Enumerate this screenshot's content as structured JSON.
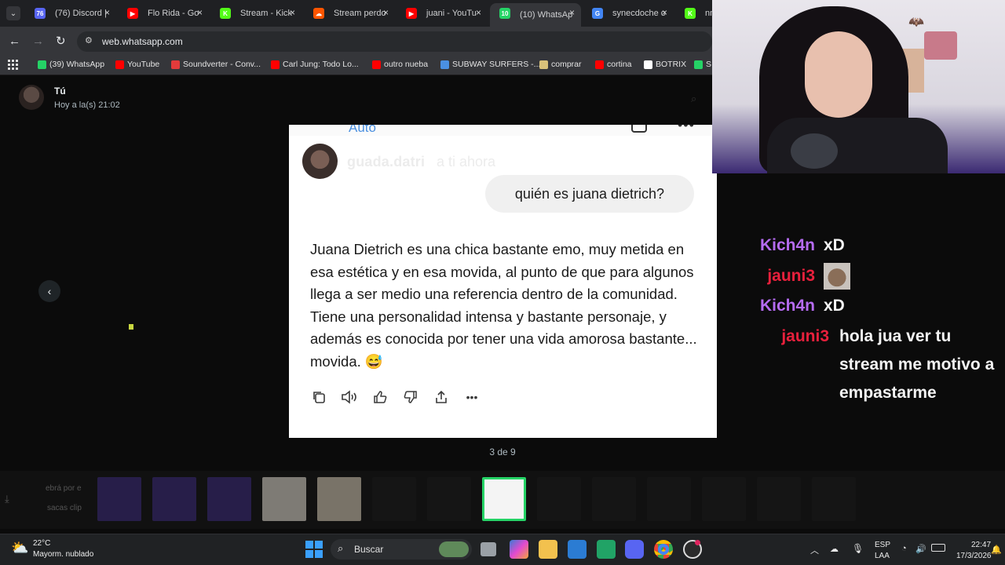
{
  "browser": {
    "tabs": [
      {
        "label": "(76) Discord |",
        "badge": "76",
        "color": "#5865f2"
      },
      {
        "label": "Flo Rida - Go",
        "badge": "▶",
        "color": "#ff0000"
      },
      {
        "label": "Stream - Kick",
        "badge": "K",
        "color": "#53fc18"
      },
      {
        "label": "Stream perdo",
        "badge": "☁",
        "color": "#ff5500"
      },
      {
        "label": "juani - YouTu",
        "badge": "▶",
        "color": "#ff0000"
      },
      {
        "label": "(10) WhatsAp",
        "badge": "10",
        "color": "#25d366"
      },
      {
        "label": "synecdoche o",
        "badge": "G",
        "color": "#4285f4"
      },
      {
        "label": "nnig",
        "badge": "K",
        "color": "#53fc18"
      }
    ],
    "url": "web.whatsapp.com",
    "bookmarks": [
      {
        "label": "(39) WhatsApp",
        "color": "#25d366"
      },
      {
        "label": "YouTube",
        "color": "#ff0000"
      },
      {
        "label": "Soundverter - Conv...",
        "color": "#e23b3b"
      },
      {
        "label": "Carl Jung: Todo Lo...",
        "color": "#ff0000"
      },
      {
        "label": "outro nueba",
        "color": "#ff0000"
      },
      {
        "label": "SUBWAY SURFERS -...",
        "color": "#4a90e2"
      },
      {
        "label": "comprar",
        "color": "#d9c27a"
      },
      {
        "label": "cortina",
        "color": "#ff0000"
      },
      {
        "label": "BOTRIX",
        "color": "#ffffff"
      },
      {
        "label": "S",
        "color": "#25d366"
      }
    ]
  },
  "viewer": {
    "sender": "Tú",
    "time": "Hoy a la(s) 21:02",
    "counter": "3 de 9"
  },
  "post": {
    "top_label": "Auto",
    "username": "guada.datri",
    "meta": "a ti  ahora",
    "question": "quién es juana dietrich?",
    "answer": "Juana Dietrich es una chica bastante emo, muy metida en esa estética y en esa movida, al punto de que para algunos llega a ser medio una referencia dentro de la comunidad. Tiene una personalidad intensa y bastante personaje, y además es conocida por tener una vida amorosa bastante... movida. 😅"
  },
  "chat": [
    {
      "user": "Kich4n",
      "message": "xD",
      "color": "#b66cf2"
    },
    {
      "user": "jauni3",
      "message": "",
      "color": "#e8203c"
    },
    {
      "user": "Kich4n",
      "message": "xD",
      "color": "#b66cf2"
    },
    {
      "user": "jauni3",
      "message": "hola jua ver tu stream me motivo a empastarme",
      "color": "#e8203c"
    }
  ],
  "thumbnails": {
    "captions": [
      "ebrá por e",
      "sacas clip"
    ]
  },
  "taskbar": {
    "weather_temp": "22°C",
    "weather_desc": "Mayorm. nublado",
    "search_placeholder": "Buscar",
    "lang1": "ESP",
    "lang2": "LAA",
    "clock_time": "22:47",
    "clock_date": "17/3/2026"
  }
}
